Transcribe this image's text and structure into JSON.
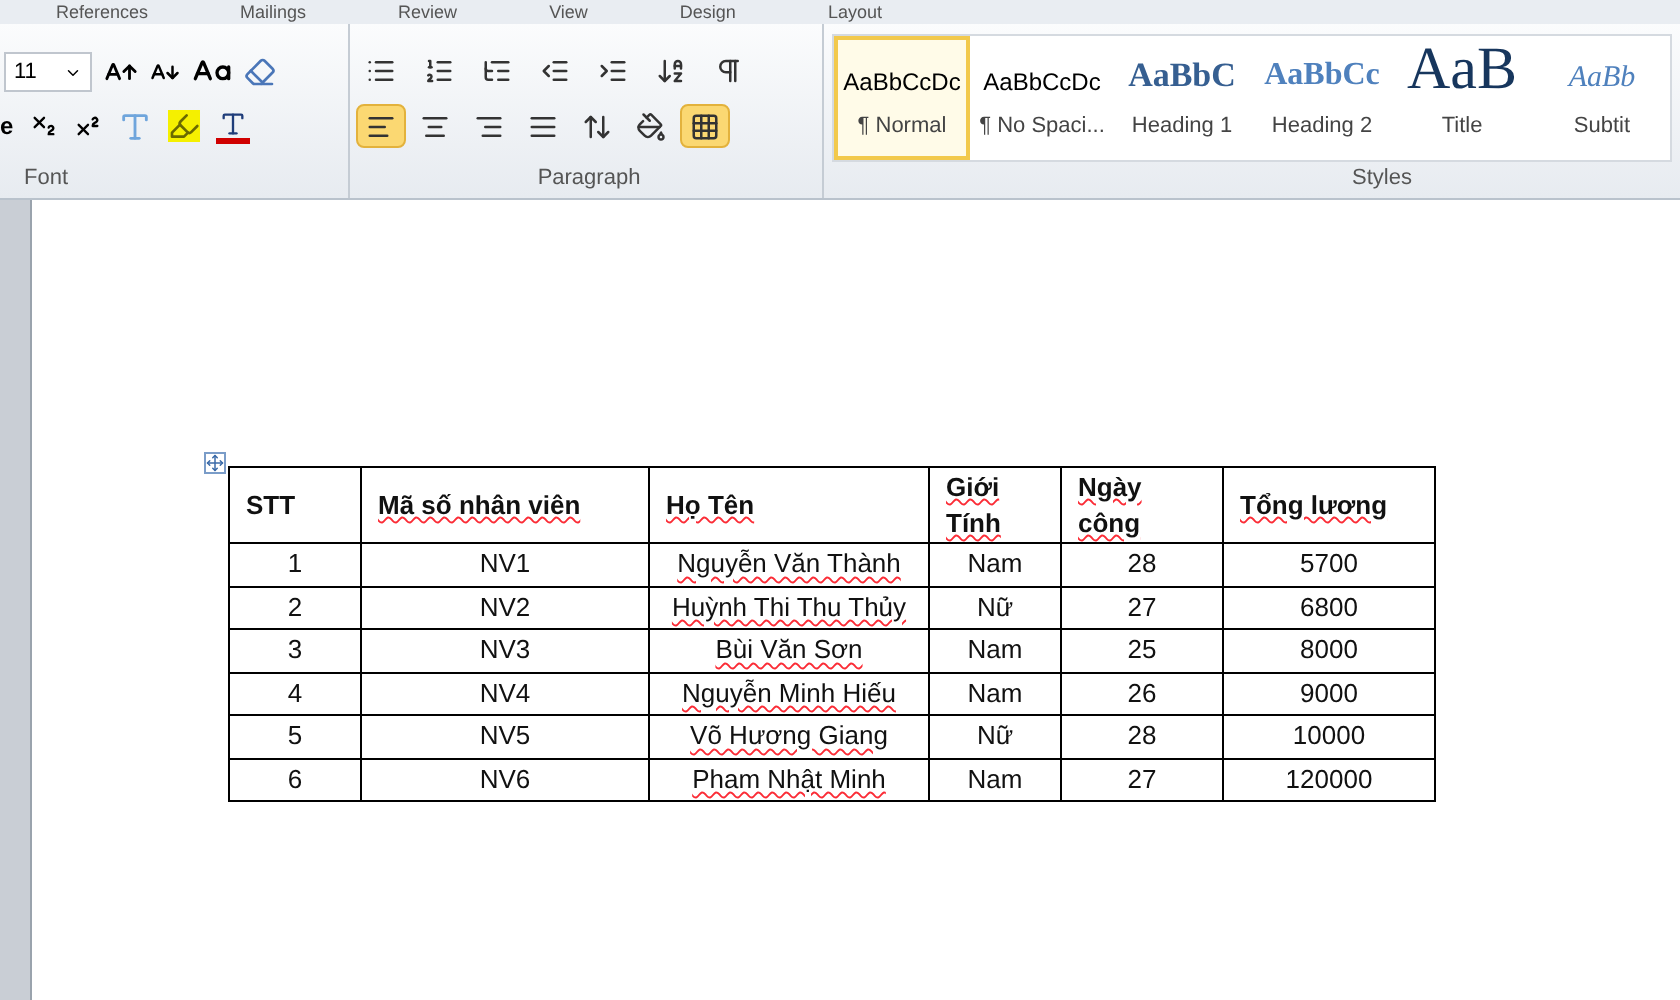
{
  "ribbon_tabs": [
    "References",
    "Mailings",
    "Review",
    "View",
    "Design",
    "Layout"
  ],
  "font_group": {
    "font_size": "11",
    "cut_glyph": "e",
    "label": "Font"
  },
  "paragraph_group": {
    "label": "Paragraph",
    "tools": [
      {
        "kind": "bullets",
        "selected": false
      },
      {
        "kind": "numbering",
        "selected": false
      },
      {
        "kind": "multilevel",
        "selected": false
      },
      {
        "kind": "outdent",
        "selected": false
      },
      {
        "kind": "indent",
        "selected": false
      },
      {
        "kind": "sort",
        "selected": false
      },
      {
        "kind": "pilcrow",
        "selected": false
      },
      {
        "kind": "align-left",
        "selected": true
      },
      {
        "kind": "align-center",
        "selected": false
      },
      {
        "kind": "align-right",
        "selected": false
      },
      {
        "kind": "justify",
        "selected": false
      },
      {
        "kind": "line-spacing",
        "selected": false
      },
      {
        "kind": "shading",
        "selected": false
      },
      {
        "kind": "borders",
        "selected": true
      }
    ]
  },
  "styles_group": {
    "label": "Styles",
    "styles": [
      {
        "preview": "AaBbCcDc",
        "name": "¶ Normal",
        "kind": "normal",
        "selected": true
      },
      {
        "preview": "AaBbCcDc",
        "name": "¶ No Spaci...",
        "kind": "normal",
        "selected": false
      },
      {
        "preview": "AaBbC",
        "name": "Heading 1",
        "kind": "heading1",
        "selected": false
      },
      {
        "preview": "AaBbCc",
        "name": "Heading 2",
        "kind": "heading2",
        "selected": false
      },
      {
        "preview": "AaB",
        "name": "Title",
        "kind": "title",
        "selected": false
      },
      {
        "preview": "AaBb",
        "name": "Subtit",
        "kind": "subtitle",
        "selected": false
      }
    ]
  },
  "table": {
    "columns": [
      "STT",
      "Mã số nhân viên",
      "Họ Tên",
      "Giới Tính",
      "Ngày công",
      "Tổng lương"
    ],
    "rows": [
      [
        "1",
        "NV1",
        "Nguyễn Văn Thành",
        "Nam",
        "28",
        "5700"
      ],
      [
        "2",
        "NV2",
        "Huỳnh Thi Thu Thủy",
        "Nữ",
        "27",
        "6800"
      ],
      [
        "3",
        "NV3",
        "Bùi Văn Sơn",
        "Nam",
        "25",
        "8000"
      ],
      [
        "4",
        "NV4",
        "Nguyễn Minh Hiếu",
        "Nam",
        "26",
        "9000"
      ],
      [
        "5",
        "NV5",
        "Võ Hương Giang",
        "Nữ",
        "28",
        "10000"
      ],
      [
        "6",
        "NV6",
        "Pham Nhật Minh",
        "Nam",
        "27",
        "120000"
      ]
    ]
  }
}
